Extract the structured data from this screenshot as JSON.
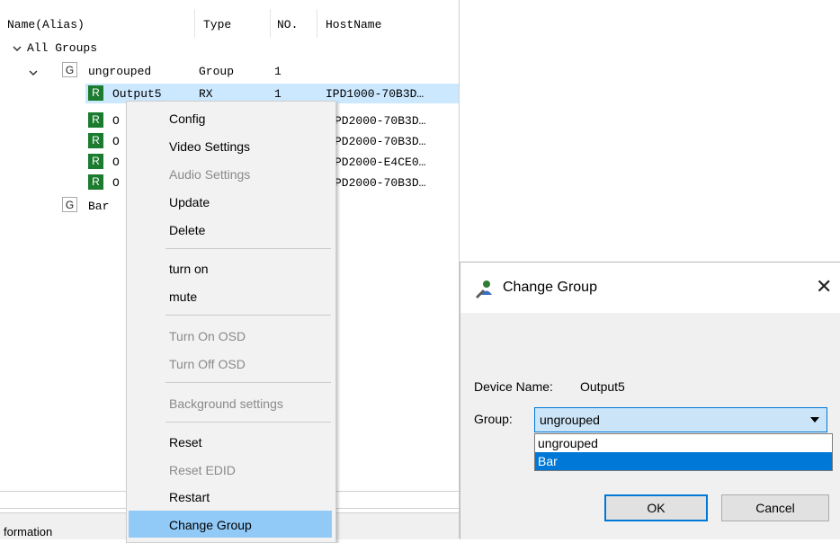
{
  "tree": {
    "columns": [
      "Name(Alias)",
      "Type",
      "NO.",
      "HostName"
    ],
    "root": "All Groups",
    "group_ungrouped": {
      "badge": "G",
      "name": "ungrouped",
      "type": "Group",
      "no": "1"
    },
    "selected_device": {
      "badge": "R",
      "name": "Output5",
      "type": "RX",
      "no": "1",
      "hostname": "IPD1000-70B3D…"
    },
    "other_devices": [
      {
        "badge": "R",
        "name": "O",
        "hostname": "PD2000-70B3D…"
      },
      {
        "badge": "R",
        "name": "O",
        "hostname": "PD2000-70B3D…"
      },
      {
        "badge": "R",
        "name": "O",
        "hostname": "PD2000-E4CE0…"
      },
      {
        "badge": "R",
        "name": "O",
        "hostname": "PD2000-70B3D…"
      }
    ],
    "group_bar": {
      "badge": "G",
      "name": "Bar"
    },
    "bottom_tab": "formation"
  },
  "context_menu": {
    "items": [
      {
        "label": "Config",
        "disabled": false
      },
      {
        "label": "Video Settings",
        "disabled": false
      },
      {
        "label": "Audio Settings",
        "disabled": true
      },
      {
        "label": "Update",
        "disabled": false
      },
      {
        "label": "Delete",
        "disabled": false
      },
      {
        "label": "turn on",
        "disabled": false
      },
      {
        "label": "mute",
        "disabled": false
      },
      {
        "label": "Turn On OSD",
        "disabled": true
      },
      {
        "label": "Turn Off OSD",
        "disabled": true
      },
      {
        "label": "Background settings",
        "disabled": true
      },
      {
        "label": "Reset",
        "disabled": false
      },
      {
        "label": "Reset EDID",
        "disabled": true
      },
      {
        "label": "Restart",
        "disabled": false
      },
      {
        "label": "Change Group",
        "disabled": false,
        "highlighted": true
      }
    ]
  },
  "dialog": {
    "title": "Change Group",
    "close_glyph": "✕",
    "device_label": "Device Name:",
    "device_value": "Output5",
    "group_label": "Group:",
    "group_value": "ungrouped",
    "options": [
      "ungrouped",
      "Bar"
    ],
    "highlighted_option": "Bar",
    "ok_label": "OK",
    "cancel_label": "Cancel"
  },
  "colors": {
    "accent": "#0078d7",
    "menu_highlight": "#91c9f7",
    "row_selected": "#cce8ff",
    "badge_r": "#1b7b2f"
  },
  "icons": [
    "chevron-down-icon",
    "group-badge-icon",
    "receiver-badge-icon",
    "change-group-icon",
    "close-icon",
    "dropdown-arrow-icon"
  ]
}
